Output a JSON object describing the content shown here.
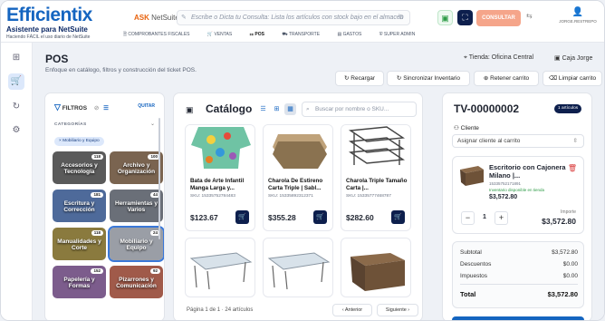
{
  "brand": {
    "logo": "Efficientix",
    "subtitle": "Asistente para NetSuite",
    "tagline": "Haciendo FÁCIL el uso diario de NetSuite"
  },
  "header": {
    "ask_label": "ASK",
    "ask_suffix": "NetSuite",
    "command_placeholder": "Escribe o Dicta tu Consulta: Lista los artículos con stock bajo en el almacén",
    "consult_button": "CONSULTAR",
    "user_name": "JORGE.RESTREPO",
    "accent": "#e8620c"
  },
  "nav": {
    "items": [
      {
        "label": "COMPROBANTES FISCALES",
        "icon": "receipt-icon"
      },
      {
        "label": "VENTAS",
        "icon": "cart-icon"
      },
      {
        "label": "POS",
        "icon": "pos-icon",
        "active": true
      },
      {
        "label": "TRANSPORTE",
        "icon": "truck-icon"
      },
      {
        "label": "GASTOS",
        "icon": "expense-icon"
      },
      {
        "label": "SUPER ADMIN",
        "icon": "shield-icon"
      }
    ]
  },
  "page": {
    "title": "POS",
    "description": "Enfoque en catálogo, filtros y construcción del ticket POS.",
    "store": "Tienda: Oficina Central",
    "register": "Caja Jorge",
    "actions": [
      "Recargar",
      "Sincronizar Inventario",
      "Retener carrito",
      "Limpiar carrito"
    ]
  },
  "filters": {
    "title": "FILTROS",
    "clear": "QUITAR",
    "section": "CATEGORÍAS",
    "active_chip": "Mobiliario y Equipo",
    "categories": [
      {
        "name": "Accesorios y Tecnología",
        "count": "118",
        "color": "#5a5a5a"
      },
      {
        "name": "Archivo y Organización",
        "count": "100",
        "color": "#7a6450"
      },
      {
        "name": "Escritura y Corrección",
        "count": "181",
        "color": "#4e6a9a"
      },
      {
        "name": "Herramientas y Varios",
        "count": "44",
        "color": "#6a6f78"
      },
      {
        "name": "Manualidades y Corte",
        "count": "118",
        "color": "#8a7a3e"
      },
      {
        "name": "Mobiliario y Equipo",
        "count": "24",
        "color": "#9a9ea6",
        "selected": true
      },
      {
        "name": "Papelería y Formas",
        "count": "152",
        "color": "#7c5c8c"
      },
      {
        "name": "Pizarrones y Comunicación",
        "count": "92",
        "color": "#a05a4a"
      }
    ]
  },
  "catalog": {
    "title": "Catálogo",
    "search_placeholder": "Buscar por nombre o SKU...",
    "products": [
      {
        "name": "Bata de Arte Infantil Manga Larga y...",
        "sku": "SKU: 15335752784483",
        "price": "$123.67"
      },
      {
        "name": "Charola De Estireno Carta Triple | Sabl...",
        "sku": "SKU: 15335892312371",
        "price": "$355.28"
      },
      {
        "name": "Charola Triple Tamaño Carta |...",
        "sku": "SKU: 15335777468787",
        "price": "$282.60"
      },
      {
        "name": "",
        "sku": "",
        "price": ""
      },
      {
        "name": "",
        "sku": "",
        "price": ""
      },
      {
        "name": "",
        "sku": "",
        "price": ""
      }
    ],
    "pager_text": "Página 1 de 1 · 24 artículos",
    "prev": "‹ Anterior",
    "next": "Siguiente ›"
  },
  "ticket": {
    "id": "TV-00000002",
    "badge": "1 artículos",
    "client_label": "Cliente",
    "client_select": "Asignar cliente al carrito",
    "item": {
      "name": "Escritorio con Cajonera Milano |...",
      "sku": "15335752171891",
      "availability": "Inventario disponible en tienda",
      "price": "$3,572.80",
      "qty": "1",
      "import_label": "Importe",
      "import_value": "$3,572.80"
    },
    "totals": [
      {
        "label": "Subtotal",
        "value": "$3,572.80"
      },
      {
        "label": "Descuentos",
        "value": "$0.00"
      },
      {
        "label": "Impuestos",
        "value": "$0.00"
      },
      {
        "label": "Total",
        "value": "$3,572.80"
      }
    ]
  }
}
